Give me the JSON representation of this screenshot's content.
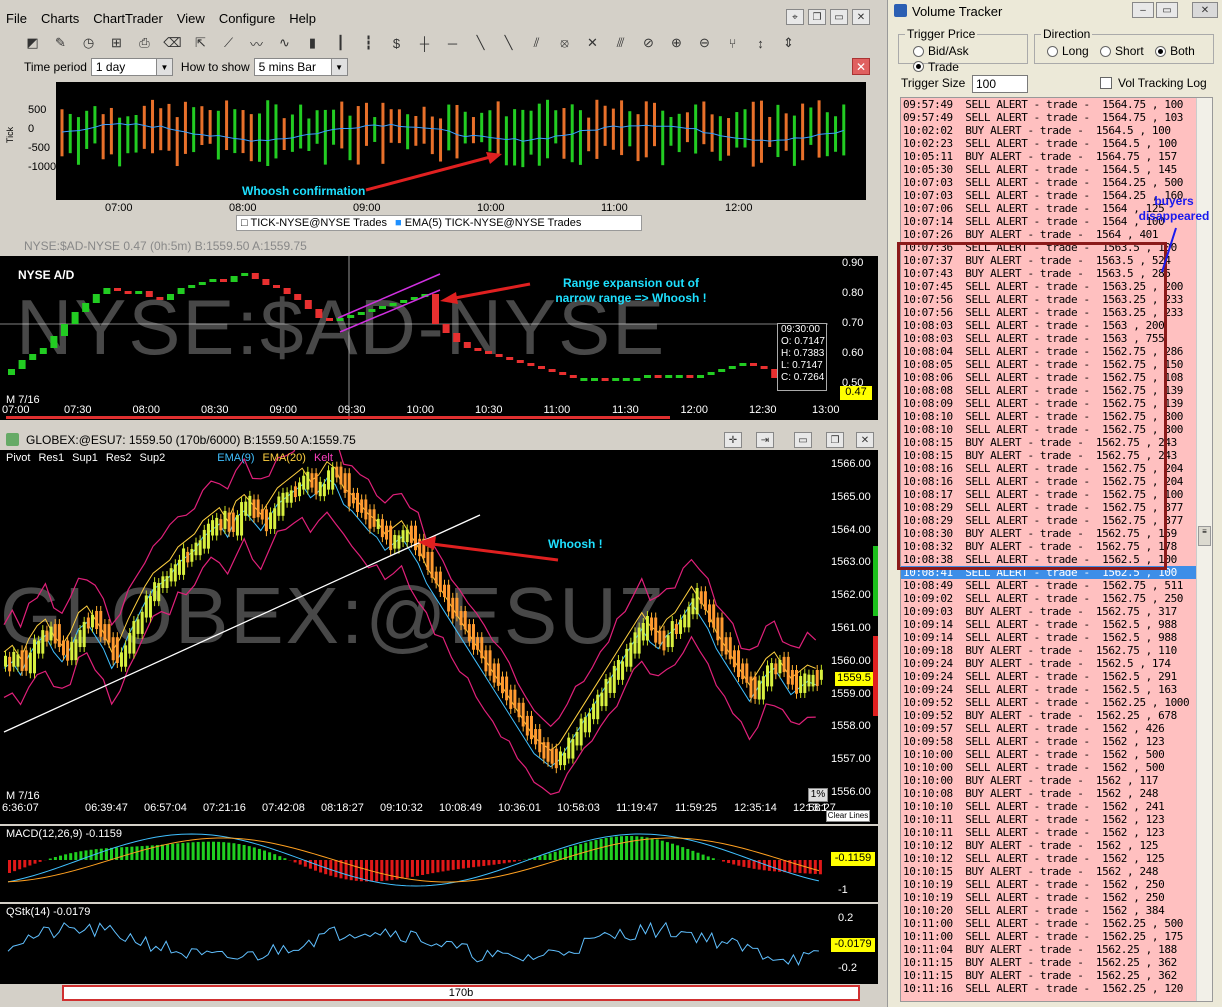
{
  "menu": [
    "File",
    "Charts",
    "ChartTrader",
    "View",
    "Configure",
    "Help"
  ],
  "period": {
    "label1": "Time period",
    "value1": "1 day",
    "label2": "How to show",
    "value2": "5 mins Bar"
  },
  "tick_chart": {
    "y_ticks": [
      "500",
      "0",
      "-500",
      "-1000"
    ],
    "y_label": "Tick",
    "x_ticks": [
      "07:00",
      "08:00",
      "09:00",
      "10:00",
      "11:00",
      "12:00"
    ],
    "legend": [
      "TICK-NYSE@NYSE Trades",
      "EMA(5) TICK-NYSE@NYSE Trades"
    ],
    "annotation": "Whoosh confirmation"
  },
  "ad_chart": {
    "title": "NYSE A/D",
    "watermark": "NYSE:$AD-NYSE",
    "header_text": "NYSE:$AD-NYSE  0.47 (0h:5m)  B:1559.50 A:1559.75",
    "y_ticks": [
      "0.90",
      "0.80",
      "0.70",
      "0.60",
      "0.50"
    ],
    "x_ticks": [
      "07:00",
      "07:30",
      "08:00",
      "08:30",
      "09:00",
      "09:30",
      "10:00",
      "10:30",
      "11:00",
      "11:30",
      "12:00",
      "12:30",
      "13:00"
    ],
    "date": "M 7/16",
    "last": "0.47",
    "annotation": "Range expansion out of narrow range => Whoosh !",
    "ohlc": {
      "time": "09:30:00",
      "o": "O: 0.7147",
      "h": "H: 0.7383",
      "l": "L: 0.7147",
      "c": "C: 0.7264"
    }
  },
  "es_chart": {
    "header": "GLOBEX:@ESU7: 1559.50 (170b/6000)  B:1559.50 A:1559.75",
    "watermark": "GLOBEX:@ESU7",
    "studies": [
      "Pivot",
      "Res1",
      "Sup1",
      "Res2",
      "Sup2",
      "EMA(9)",
      "EMA(20)",
      "Kelt"
    ],
    "y_ticks": [
      "1566.00",
      "1565.00",
      "1564.00",
      "1563.00",
      "1562.00",
      "1561.00",
      "1560.00",
      "1559.00",
      "1558.00",
      "1557.00",
      "1556.00"
    ],
    "x_ticks": [
      "6:36:07",
      "06:39:47",
      "06:57:04",
      "07:21:16",
      "07:42:08",
      "08:18:27",
      "09:10:32",
      "10:08:49",
      "10:36:01",
      "10:58:03",
      "11:19:47",
      "11:59:25",
      "12:35:14",
      "12:58:27",
      "13:1"
    ],
    "date": "M 7/16",
    "last": "1559.5",
    "annotation": "Whoosh !",
    "pct": "1%",
    "clear": "Clear Lines"
  },
  "macd": {
    "label": "MACD(12,26,9)  -0.1159",
    "y_ticks": [
      "0",
      "-1"
    ],
    "last": "-0.1159"
  },
  "qstk": {
    "label": "QStk(14)  -0.0179",
    "y_ticks": [
      "0.2",
      "-0.2"
    ],
    "last": "-0.0179"
  },
  "scrollbar": {
    "label": "170b"
  },
  "vt": {
    "title": "Volume Tracker",
    "trigger_price": "Trigger Price",
    "bid_ask": "Bid/Ask",
    "trade": "Trade",
    "direction": "Direction",
    "long": "Long",
    "short": "Short",
    "both": "Both",
    "trigger_size_label": "Trigger Size",
    "trigger_size": "100",
    "vol_log": "Vol Tracking Log",
    "annotation": "buyers disappeared"
  },
  "alerts": [
    "09:57:49  SELL ALERT - trade -  1564.75 , 100",
    "09:57:49  SELL ALERT - trade -  1564.75 , 103",
    "10:02:02  BUY ALERT - trade -  1564.5 , 100",
    "10:02:23  SELL ALERT - trade -  1564.5 , 100",
    "10:05:11  BUY ALERT - trade -  1564.75 , 157",
    "10:05:30  SELL ALERT - trade -  1564.5 , 145",
    "10:07:03  SELL ALERT - trade -  1564.25 , 500",
    "10:07:03  SELL ALERT - trade -  1564.25 , 160",
    "10:07:06  SELL ALERT - trade -  1564 , 125",
    "10:07:14  SELL ALERT - trade -  1564 , 100",
    "10:07:26  BUY ALERT - trade -  1564 , 401",
    "10:07:36  SELL ALERT - trade -  1563.5 , 100",
    "10:07:37  BUY ALERT - trade -  1563.5 , 524",
    "10:07:43  BUY ALERT - trade -  1563.5 , 285",
    "10:07:45  SELL ALERT - trade -  1563.25 , 200",
    "10:07:56  SELL ALERT - trade -  1563.25 , 233",
    "10:07:56  SELL ALERT - trade -  1563.25 , 233",
    "10:08:03  SELL ALERT - trade -  1563 , 200",
    "10:08:03  SELL ALERT - trade -  1563 , 755",
    "10:08:04  SELL ALERT - trade -  1562.75 , 286",
    "10:08:05  SELL ALERT - trade -  1562.75 , 150",
    "10:08:06  SELL ALERT - trade -  1562.75 , 108",
    "10:08:08  SELL ALERT - trade -  1562.75 , 139",
    "10:08:09  SELL ALERT - trade -  1562.75 , 139",
    "10:08:10  SELL ALERT - trade -  1562.75 , 300",
    "10:08:10  SELL ALERT - trade -  1562.75 , 300",
    "10:08:15  BUY ALERT - trade -  1562.75 , 243",
    "10:08:15  BUY ALERT - trade -  1562.75 , 243",
    "10:08:16  SELL ALERT - trade -  1562.75 , 204",
    "10:08:16  SELL ALERT - trade -  1562.75 , 204",
    "10:08:17  SELL ALERT - trade -  1562.75 , 100",
    "10:08:29  SELL ALERT - trade -  1562.75 , 377",
    "10:08:29  SELL ALERT - trade -  1562.75 , 377",
    "10:08:30  BUY ALERT - trade -  1562.75 , 159",
    "10:08:32  BUY ALERT - trade -  1562.75 , 178",
    "10:08:38  SELL ALERT - trade -  1562.5 , 100",
    "10:08:41  SELL ALERT - trade -  1562.5 , 100",
    "10:08:49  SELL ALERT - trade -  1562.75 , 511",
    "10:09:02  SELL ALERT - trade -  1562.75 , 250",
    "10:09:03  BUY ALERT - trade -  1562.75 , 317",
    "10:09:14  SELL ALERT - trade -  1562.5 , 988",
    "10:09:14  SELL ALERT - trade -  1562.5 , 988",
    "10:09:18  BUY ALERT - trade -  1562.75 , 110",
    "10:09:24  BUY ALERT - trade -  1562.5 , 174",
    "10:09:24  SELL ALERT - trade -  1562.5 , 291",
    "10:09:24  SELL ALERT - trade -  1562.5 , 163",
    "10:09:52  SELL ALERT - trade -  1562.25 , 1000",
    "10:09:52  BUY ALERT - trade -  1562.25 , 678",
    "10:09:57  SELL ALERT - trade -  1562 , 426",
    "10:09:58  SELL ALERT - trade -  1562 , 123",
    "10:10:00  SELL ALERT - trade -  1562 , 500",
    "10:10:00  SELL ALERT - trade -  1562 , 500",
    "10:10:00  BUY ALERT - trade -  1562 , 117",
    "10:10:08  BUY ALERT - trade -  1562 , 248",
    "10:10:10  SELL ALERT - trade -  1562 , 241",
    "10:10:11  SELL ALERT - trade -  1562 , 123",
    "10:10:11  SELL ALERT - trade -  1562 , 123",
    "10:10:12  BUY ALERT - trade -  1562 , 125",
    "10:10:12  SELL ALERT - trade -  1562 , 125",
    "10:10:15  BUY ALERT - trade -  1562 , 248",
    "10:10:19  SELL ALERT - trade -  1562 , 250",
    "10:10:19  SELL ALERT - trade -  1562 , 250",
    "10:10:20  SELL ALERT - trade -  1562 , 384",
    "10:11:00  SELL ALERT - trade -  1562.25 , 500",
    "10:11:00  SELL ALERT - trade -  1562.25 , 175",
    "10:11:04  BUY ALERT - trade -  1562.25 , 188",
    "10:11:15  BUY ALERT - trade -  1562.25 , 362",
    "10:11:15  BUY ALERT - trade -  1562.25 , 362",
    "10:11:16  SELL ALERT - trade -  1562.25 , 120"
  ],
  "selected_alert_index": 36,
  "colors": {
    "up": "#22cc22",
    "down": "#e8702a",
    "list_bg": "#ffc0c0",
    "highlight": "#8b1a1a"
  }
}
